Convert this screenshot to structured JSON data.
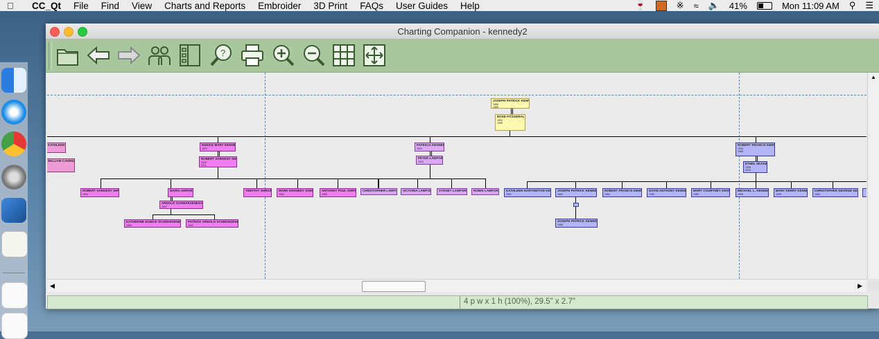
{
  "menubar": {
    "app_name": "CC_Qt",
    "items": [
      "File",
      "Find",
      "View",
      "Charts and Reports",
      "Embroider",
      "3D Print",
      "FAQs",
      "User Guides",
      "Help"
    ],
    "battery": "41%",
    "clock": "Mon 11:09 AM"
  },
  "window": {
    "title": "Charting Companion - kennedy2"
  },
  "toolbar": {
    "buttons": [
      "open",
      "back",
      "forward",
      "people",
      "list",
      "help",
      "print",
      "zoom-in",
      "zoom-out",
      "grid",
      "fit"
    ]
  },
  "status": {
    "text": "4 p w x 1 h (100%), 29.5\" x 2.7\""
  },
  "chart": {
    "boxes": [
      {
        "id": "jpk",
        "name": "JOSEPH PATRICK KENNEDY",
        "lines": [
          "1888",
          "1969"
        ],
        "style": "y"
      },
      {
        "id": "rf",
        "name": "ROSE FITZGERALD",
        "lines": [
          "1890",
          "1995"
        ],
        "style": "y"
      },
      {
        "id": "kk",
        "name": "KATHLEEN KENNEDY",
        "lines": [],
        "style": "p"
      },
      {
        "id": "cav",
        "name": "WILLIAM CAVENDISH",
        "lines": [],
        "style": "p"
      },
      {
        "id": "ek",
        "name": "EUNICE MARY KENNEDY",
        "lines": [
          "1921"
        ],
        "style": "m"
      },
      {
        "id": "rs",
        "name": "ROBERT SARGENT SHRIVER",
        "lines": [
          "1915",
          "2011"
        ],
        "style": "m"
      },
      {
        "id": "rss",
        "name": "ROBERT SARGENT SHRIVER",
        "lines": [
          "1954"
        ],
        "style": "m"
      },
      {
        "id": "ms",
        "name": "MARIA SHRIVER",
        "lines": [],
        "style": "m"
      },
      {
        "id": "as",
        "name": "ARNOLD SCHWARZENEGGER",
        "lines": [
          "1947"
        ],
        "style": "m"
      },
      {
        "id": "ts",
        "name": "TIMOTHY SHRIVER",
        "lines": [],
        "style": "m"
      },
      {
        "id": "mks",
        "name": "MARK KENNEDY SHRIVER",
        "lines": [
          "1964"
        ],
        "style": "m"
      },
      {
        "id": "aps",
        "name": "ANTHONY PAUL SHRIVER",
        "lines": [
          "1965"
        ],
        "style": "m"
      },
      {
        "id": "ks",
        "name": "KATHERINE EUNICE SCHWARZENEGGER",
        "lines": [
          "1989"
        ],
        "style": "m"
      },
      {
        "id": "ps",
        "name": "PATRICK ARNOLD SCHWARZENEGGER",
        "lines": [
          "1993"
        ],
        "style": "m"
      },
      {
        "id": "pk",
        "name": "PATRICIA KENNEDY",
        "lines": [
          "1924"
        ],
        "style": "l"
      },
      {
        "id": "pl",
        "name": "PETER LAWFORD",
        "lines": [
          "1923"
        ],
        "style": "l"
      },
      {
        "id": "cl",
        "name": "CHRISTOPHER LAWFORD",
        "lines": [],
        "style": "l"
      },
      {
        "id": "vl",
        "name": "VICTORIA LAWFORD",
        "lines": [],
        "style": "l"
      },
      {
        "id": "sl",
        "name": "SYDNEY LAWFORD",
        "lines": [],
        "style": "l"
      },
      {
        "id": "rl",
        "name": "ROBIN LAWFORD",
        "lines": [],
        "style": "l"
      },
      {
        "id": "rfk",
        "name": "ROBERT FRANCIS KENNEDY",
        "lines": [
          "1925",
          "1968"
        ],
        "style": "b"
      },
      {
        "id": "es",
        "name": "ETHEL SKAKEL",
        "lines": [
          "1928",
          "2024"
        ],
        "style": "b"
      },
      {
        "id": "khk",
        "name": "KATHLEEN HARTINGTON KENNEDY",
        "lines": [
          "1951"
        ],
        "style": "b"
      },
      {
        "id": "jpk2",
        "name": "JOSEPH PATRICK KENNEDY II",
        "lines": [
          "1952"
        ],
        "style": "b"
      },
      {
        "id": "jpk3",
        "name": "JOSEPH PATRICK KENNEDY III",
        "lines": [
          "1980"
        ],
        "style": "b"
      },
      {
        "id": "rfkjr",
        "name": "ROBERT FRANCIS KENNEDY",
        "lines": [
          "1954"
        ],
        "style": "b"
      },
      {
        "id": "dak",
        "name": "DAVID ANTHONY KENNEDY",
        "lines": [
          "1955"
        ],
        "style": "b"
      },
      {
        "id": "mck",
        "name": "MARY COURTNEY KENNEDY",
        "lines": [
          "1956"
        ],
        "style": "b"
      },
      {
        "id": "mlk",
        "name": "MICHAEL L. KENNEDY",
        "lines": [
          "1958"
        ],
        "style": "b"
      },
      {
        "id": "mkk",
        "name": "MARY KERRY KENNEDY",
        "lines": [
          "1959"
        ],
        "style": "b"
      },
      {
        "id": "cgk",
        "name": "CHRISTOPHER GEORGE KENNEDY",
        "lines": [
          "1963"
        ],
        "style": "b"
      }
    ]
  }
}
